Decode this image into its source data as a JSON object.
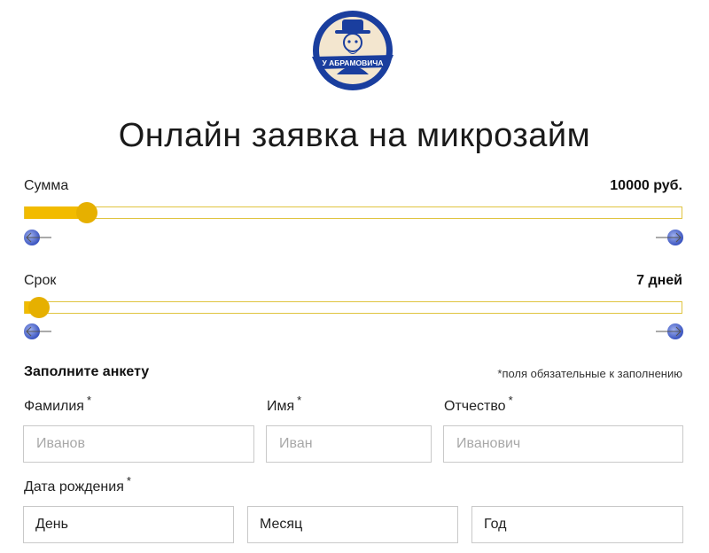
{
  "logo": {
    "text": "У АБРАМОВИЧА",
    "colors": {
      "blue": "#1a3e9e",
      "cream": "#f3e6cf"
    }
  },
  "page_title": "Онлайн заявка на микрозайм",
  "amount": {
    "label": "Сумма",
    "value_text": "10000 руб.",
    "fill_fraction": 0.095
  },
  "term": {
    "label": "Срок",
    "value_text": "7 дней",
    "fill_fraction": 0.022
  },
  "form": {
    "title": "Заполните анкету",
    "required_note": "*поля обязательные к заполнению",
    "required_mark": "*",
    "last_name": {
      "label": "Фамилия",
      "placeholder": "Иванов"
    },
    "first_name": {
      "label": "Имя",
      "placeholder": "Иван"
    },
    "patronymic": {
      "label": "Отчество",
      "placeholder": "Иванович"
    },
    "birth_date": {
      "label": "Дата рождения",
      "day": "День",
      "month": "Месяц",
      "year": "Год"
    }
  },
  "colors": {
    "accent": "#f2bb00",
    "thumb": "#e6b000",
    "arrow_blue": "#4a63c8"
  },
  "icons": {
    "decrease": "arrow-left-icon",
    "increase": "arrow-right-icon"
  }
}
